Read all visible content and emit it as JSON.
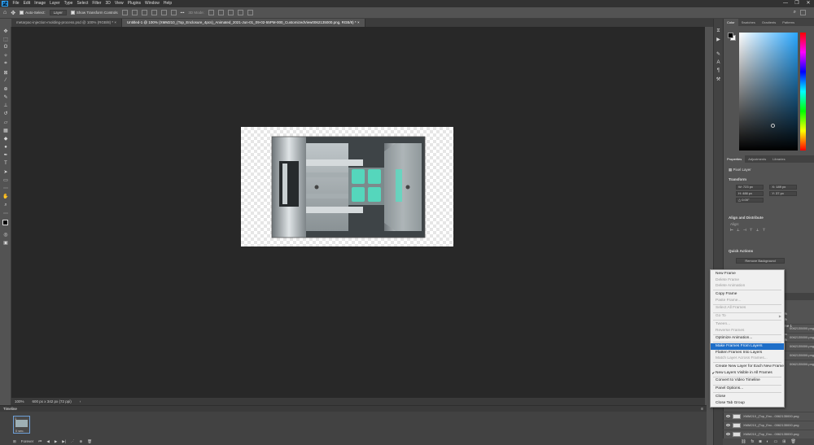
{
  "menubar": {
    "logo": "Ps",
    "items": [
      "File",
      "Edit",
      "Image",
      "Layer",
      "Type",
      "Select",
      "Filter",
      "3D",
      "View",
      "Plugins",
      "Window",
      "Help"
    ],
    "window_controls": [
      "—",
      "❐",
      "✕"
    ]
  },
  "options": {
    "auto_select": "Auto-Select:",
    "target": "Layer",
    "transform": "Show Transform Controls",
    "mode_3d": "3D Mode:"
  },
  "tabs": [
    {
      "label": "metarpac-injection-molding-process.psd @ 100% (RGB/8) *",
      "close": "×"
    },
    {
      "label": "Untitled-1 @ 100% (XMM210_(Top_Enclosure_4pcs)_Animated_2021-Jun-01_09-02-55PM-000_CustomizedView0062135000.png, RGB/8) *",
      "close": "×"
    }
  ],
  "status": {
    "zoom": "100%",
    "size": "600 px x 342 px (72 ppi)"
  },
  "timeline": {
    "title": "Timeline",
    "frame_number": "1",
    "frame_delay": "0 sec.",
    "loop": "Forever"
  },
  "right_panel": {
    "color_tabs": [
      "Color",
      "Swatches",
      "Gradients",
      "Patterns"
    ],
    "prop_tabs": [
      "Properties",
      "Adjustments",
      "Libraries"
    ],
    "pixel_layer": "Pixel Layer",
    "transform_title": "Transform",
    "w": "W: 723 px",
    "h": "H: 488 px",
    "x": "X: 189 px",
    "y": "Y: 37 px",
    "angle": "△ 0.00°",
    "align_title": "Align and Distribute",
    "align_label": "Align:",
    "quick_actions_title": "Quick Actions",
    "remove_bg": "Remove Background"
  },
  "context_menu": {
    "items": [
      {
        "label": "New Frame",
        "state": "normal"
      },
      {
        "label": "Delete Frame",
        "state": "disabled"
      },
      {
        "label": "Delete Animation",
        "state": "disabled"
      },
      {
        "sep": true
      },
      {
        "label": "Copy Frame",
        "state": "normal"
      },
      {
        "label": "Paste Frame...",
        "state": "disabled"
      },
      {
        "sep": true
      },
      {
        "label": "Select All Frames",
        "state": "disabled"
      },
      {
        "sep": true
      },
      {
        "label": "Go To",
        "state": "disabled",
        "arrow": true
      },
      {
        "sep": true
      },
      {
        "label": "Tween...",
        "state": "disabled"
      },
      {
        "label": "Reverse Frames",
        "state": "disabled"
      },
      {
        "sep": true
      },
      {
        "label": "Optimize Animation...",
        "state": "normal"
      },
      {
        "sep": true
      },
      {
        "label": "Make Frames From Layers",
        "state": "highlight"
      },
      {
        "label": "Flatten Frames Into Layers",
        "state": "normal"
      },
      {
        "label": "Match Layer Across Frames...",
        "state": "disabled"
      },
      {
        "sep": true
      },
      {
        "label": "Create New Layer for Each New Frame",
        "state": "normal"
      },
      {
        "label": "New Layers Visible in All Frames",
        "state": "checked"
      },
      {
        "sep": true
      },
      {
        "label": "Convert to Video Timeline",
        "state": "normal"
      },
      {
        "sep": true
      },
      {
        "label": "Panel Options...",
        "state": "normal"
      },
      {
        "sep": true
      },
      {
        "label": "Close",
        "state": "normal"
      },
      {
        "label": "Close Tab Group",
        "state": "normal"
      }
    ]
  },
  "layers": {
    "peek_texts": [
      "%",
      "%",
      "me 1",
      "%",
      "%"
    ],
    "rows": [
      "0062135000.png",
      "0062135000.png",
      "0062135000.png",
      "0062135000.png",
      "0062135000.png",
      "XMM210_(Top_Enc...0062135000.png",
      "XMM210_(Top_Enc...0062135000.png",
      "XMM210_(Top_Enc...0062135000.png"
    ]
  },
  "colors": {
    "menubar": "#323232",
    "panel": "#535353",
    "workarea": "#282828",
    "accent_highlight": "#1e6ec8",
    "teal_glow": "#4fe3c4"
  }
}
